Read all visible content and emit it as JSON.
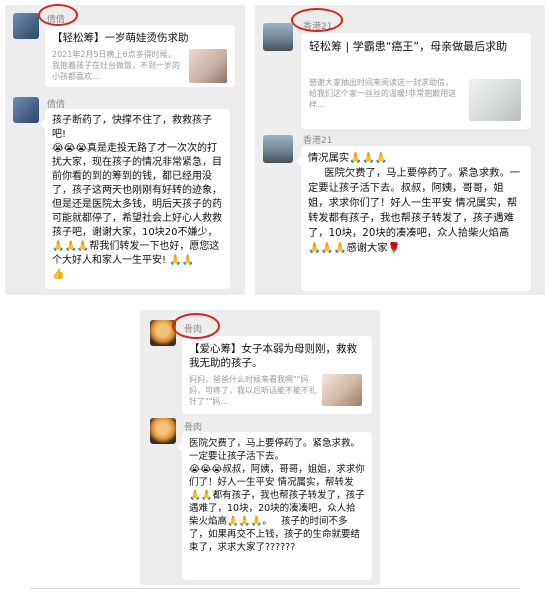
{
  "accent": "#d8231a",
  "p1": {
    "m1": {
      "name": "倩倩",
      "card_title": "【轻松筹】一岁萌娃烫伤求助",
      "card_desc": "2021年2月5日晚上6点多得时候，我抱着孩子在灶台做饭，不到一岁的小孩都喜欢…"
    },
    "m2": {
      "name": "倩倩",
      "text": "孩子断药了，快撑不住了，救救孩子吧!\n😭😭😭真是走投无路了才一次次的打扰大家，现在孩子的情况非常紧急，目前你看的到的筹到的钱，都已经用没了，孩子这两天也刚刚有好转的迹象，但是还是医院太多钱，明后天孩子的药可能就都停了，希望社会上好心人救救孩子吧，谢谢大家，10块20不嫌少，🙏🙏🙏帮我们转发一下也好，愿您这个大好人和家人一生平安! 🙏🙏\n👍"
    }
  },
  "p2": {
    "m1": {
      "name": "香港21",
      "card_title": "轻松筹 | 学霸患“癌王”，母亲做最后求助",
      "card_desc": "感谢大家抽出时间来阅读这一封求助信，给我们这个家一丝丝的温暖!非常抱歉用这样…"
    },
    "m2": {
      "name": "香港21",
      "text": "情况属实🙏🙏🙏\n     医院欠费了，马上要停药了。紧急求救。一定要让孩子活下去。叔叔，阿姨，哥哥，姐姐，求求你们了！好人一生平安 情况属实，帮转发都有孩子，我也帮孩子转发了，孩子遇难了，10块，20块的凑凑吧，众人拾柴火焰高 🙏🙏🙏感谢大家🌹"
    }
  },
  "p3": {
    "m1": {
      "name": "骨肉",
      "card_title": "【爱心筹】女子本弱为母则刚，救救我无助的孩子。",
      "card_desc": "妈妈，爸爸什么时候来看我啊\"\"妈妈，可疼了，我以后听话能不能不扎针了\"\"妈…"
    },
    "m2": {
      "name": "骨肉",
      "text": "医院欠费了，马上要停药了。紧急求救。一定要让孩子活下去。\n😭😭😭叔叔，阿姨，哥哥，姐姐，求求你们了！好人一生平安 情况属实，帮转发🙏🙏都有孩子，我也帮孩子转发了，孩子遇难了，10块，20块的凑凑吧，众人拾柴火焰高🙏🙏🙏。   孩子的时间不多了，如果再交不上钱，孩子的生命就要结束了，求求大家了??????"
    }
  }
}
